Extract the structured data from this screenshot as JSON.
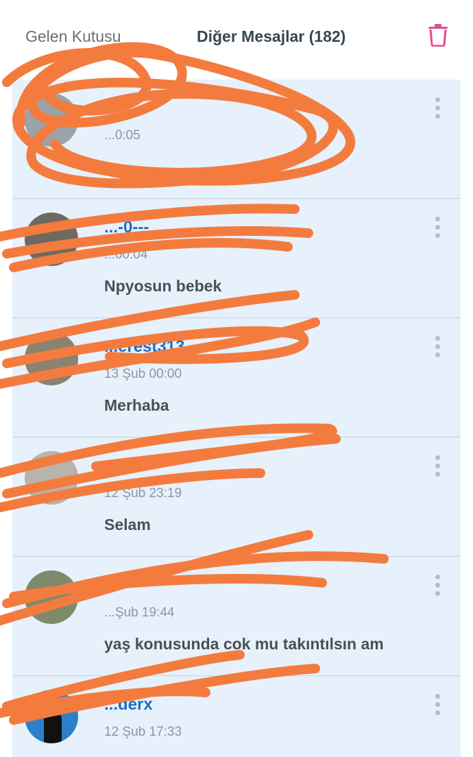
{
  "header": {
    "inbox_tab": "Gelen Kutusu",
    "other_tab": "Diğer Mesajlar (182)",
    "trash_icon": "trash-icon",
    "accent": "#e44b8d"
  },
  "messages": [
    {
      "user": "",
      "date": "...0:05",
      "text": ""
    },
    {
      "user": "...-0---",
      "date": "...00:04",
      "text": "Npyosun bebek"
    },
    {
      "user": "...erest313",
      "date": "13 Şub 00:00",
      "text": "Merhaba"
    },
    {
      "user": "...00",
      "date": "12 Şub 23:19",
      "text": "Selam"
    },
    {
      "user": "",
      "date": "...Şub 19:44",
      "text": "yaş konusunda cok mu takıntılsın am"
    },
    {
      "user": "...derx",
      "date": "12 Şub 17:33",
      "text": ""
    }
  ],
  "colors": {
    "list_bg": "#e6f1fc",
    "username": "#1e6fbf",
    "scribble": "#f47b3e"
  }
}
